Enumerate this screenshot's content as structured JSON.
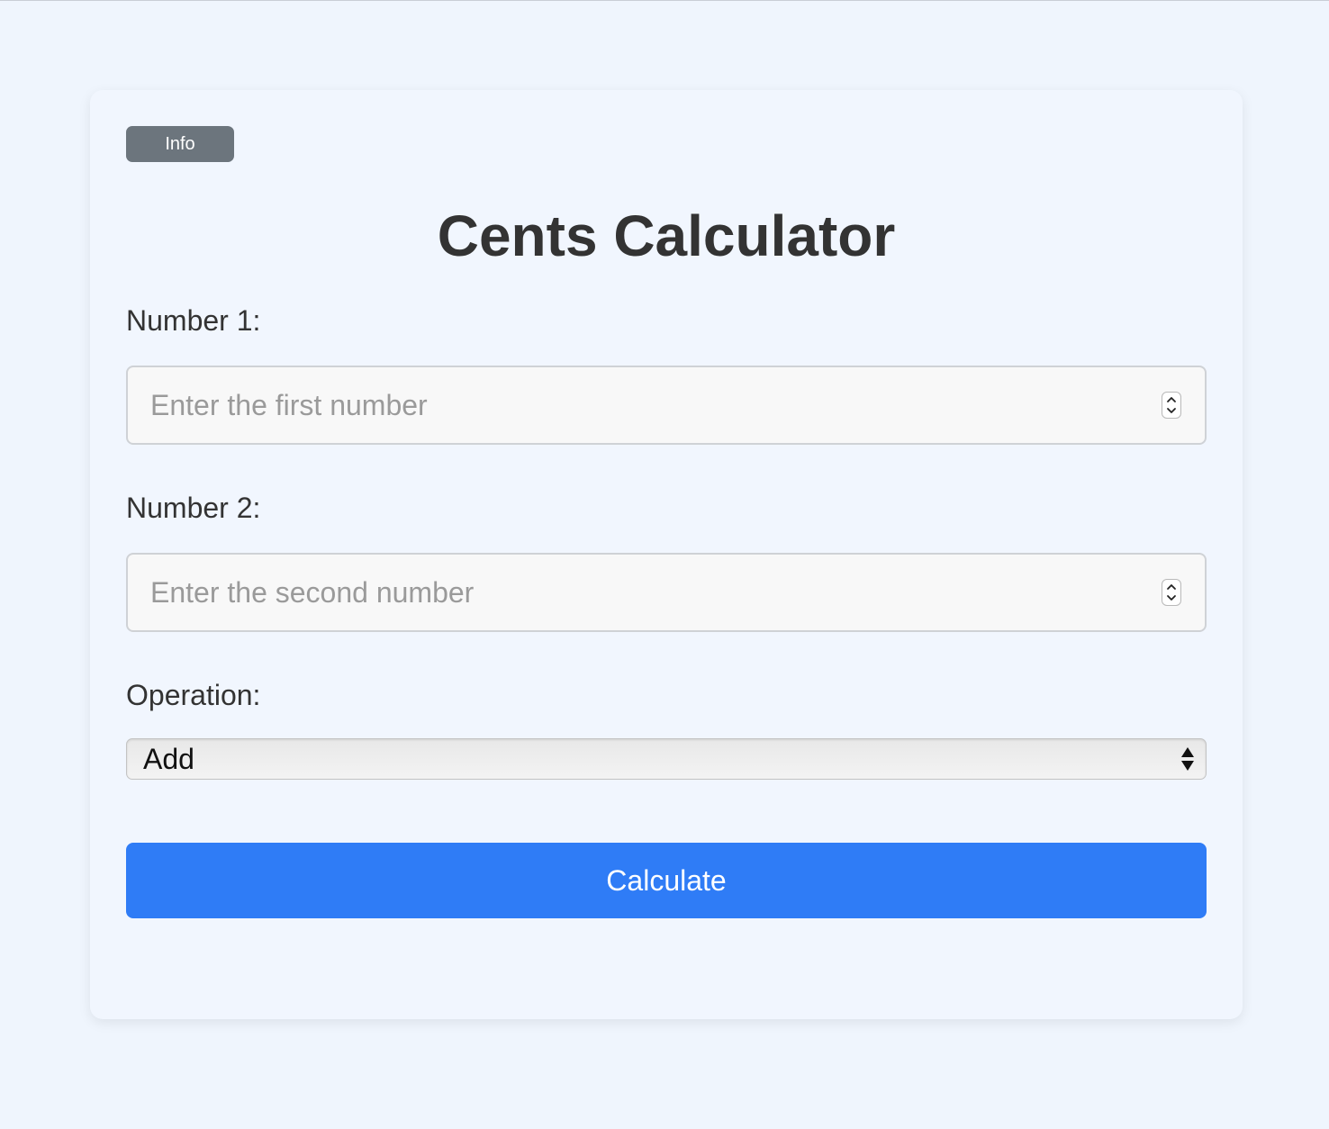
{
  "info_button": {
    "label": "Info"
  },
  "title": "Cents Calculator",
  "form": {
    "number1": {
      "label": "Number 1:",
      "placeholder": "Enter the first number",
      "value": ""
    },
    "number2": {
      "label": "Number 2:",
      "placeholder": "Enter the second number",
      "value": ""
    },
    "operation": {
      "label": "Operation:",
      "selected": "Add"
    }
  },
  "calculate_button": {
    "label": "Calculate"
  },
  "icons": {
    "stepper": "up-down-chevron-icon",
    "select_arrows": "up-down-triangle-icon"
  },
  "colors": {
    "page_background": "#eff5fd",
    "card_background": "#f1f6fe",
    "info_button": "#6c757d",
    "primary_button": "#2f7cf6",
    "text": "#333333",
    "placeholder": "#9a9a9a"
  }
}
